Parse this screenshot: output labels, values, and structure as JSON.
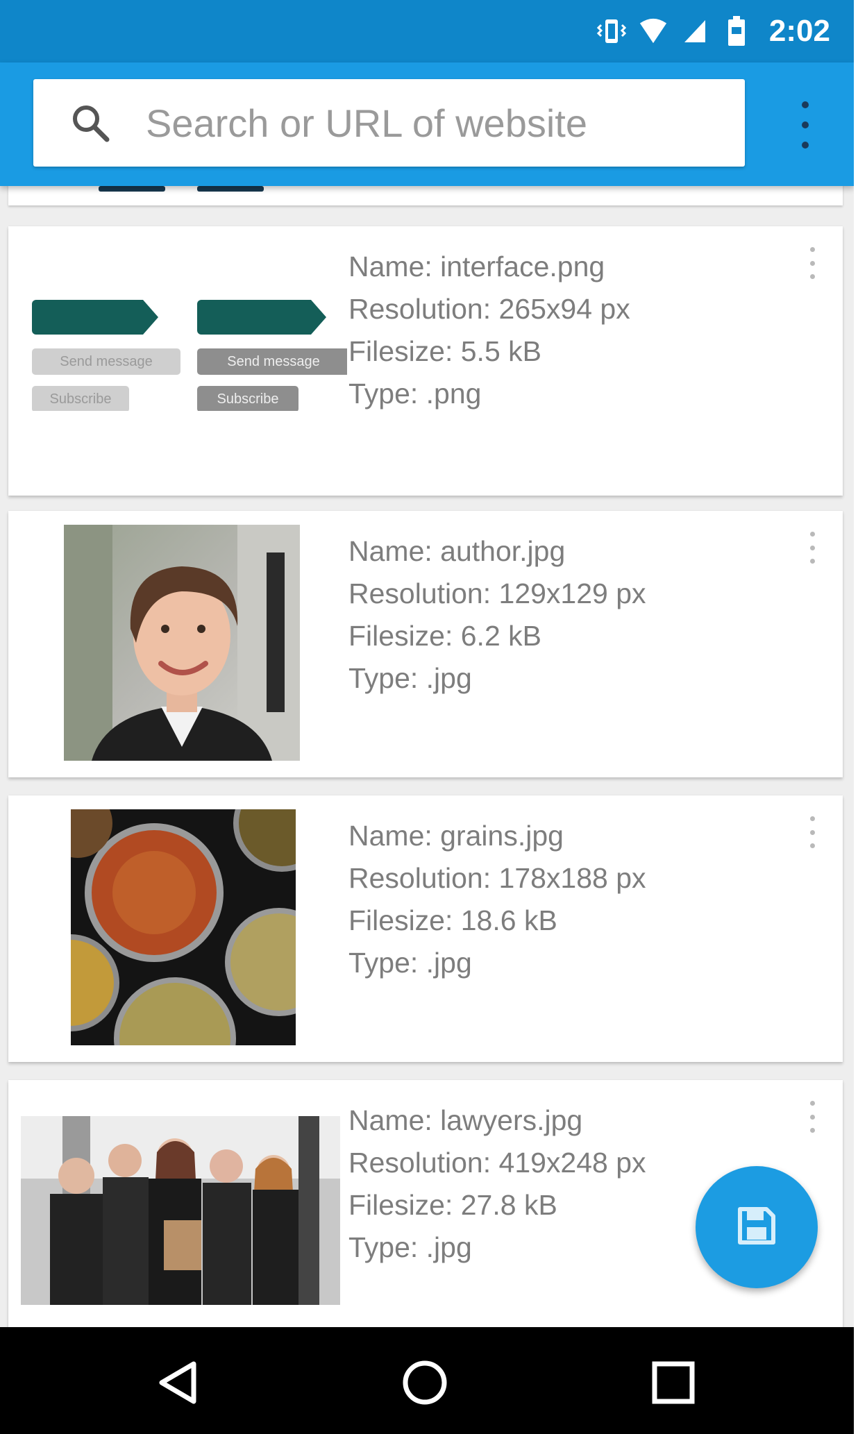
{
  "status_bar": {
    "time": "2:02",
    "icons": [
      "vibrate-icon",
      "wifi-icon",
      "cell-signal-icon",
      "battery-icon"
    ]
  },
  "app_bar": {
    "search_placeholder": "Search or URL of website",
    "search_icon": "search-icon",
    "menu_icon": "overflow-menu-icon"
  },
  "images": [
    {
      "name": "Name: interface.png",
      "resolution": "Resolution: 265x94 px",
      "filesize": "Filesize: 5.5 kB",
      "type": "Type: .png",
      "thumbnail_chips": [
        "Send message",
        "Subscribe",
        "Send message",
        "Subscribe"
      ]
    },
    {
      "name": "Name: author.jpg",
      "resolution": "Resolution: 129x129 px",
      "filesize": "Filesize: 6.2 kB",
      "type": "Type: .jpg"
    },
    {
      "name": "Name: grains.jpg",
      "resolution": "Resolution: 178x188 px",
      "filesize": "Filesize: 18.6 kB",
      "type": "Type: .jpg"
    },
    {
      "name": "Name: lawyers.jpg",
      "resolution": "Resolution: 419x248 px",
      "filesize": "Filesize: 27.8 kB",
      "type": "Type: .jpg"
    }
  ],
  "fab": {
    "icon": "save-icon"
  },
  "nav_bar": {
    "icons": [
      "back-icon",
      "home-icon",
      "recents-icon"
    ]
  },
  "colors": {
    "status_bar": "#0f86c9",
    "app_bar": "#1a9be3",
    "fab": "#1c9ce2",
    "background": "#eeeeee",
    "card": "#ffffff",
    "text": "#7d7d7d"
  }
}
